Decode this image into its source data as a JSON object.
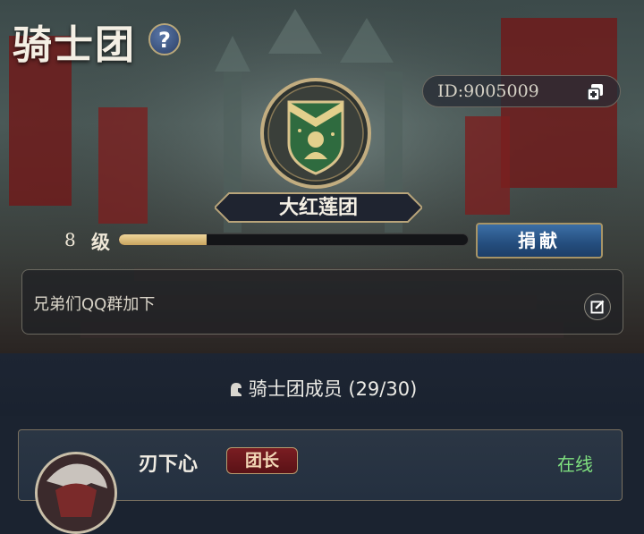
{
  "header": {
    "title": "骑士团",
    "help_icon": "question-circle-icon"
  },
  "guild": {
    "id_text": "ID:9005009",
    "copy_icon": "copy-icon",
    "emblem_icon": "guild-shield-emblem-icon",
    "name": "大红莲团",
    "level_number": "8",
    "level_unit": "级",
    "exp_progress": 0.25,
    "donate_label": "捐献"
  },
  "notice": {
    "text": "兄弟们QQ群加下",
    "edit_icon": "edit-icon"
  },
  "members": {
    "header_icon": "knight-icon",
    "header_text": "骑士团成员 (29/30)",
    "list": [
      {
        "name": "刃下心",
        "role": "团长",
        "status": "在线"
      }
    ]
  },
  "colors": {
    "accent_gold": "#c9a55f",
    "button_blue": "#2b5a8f",
    "online_green": "#7fe07f",
    "role_red": "#7a1d22"
  }
}
